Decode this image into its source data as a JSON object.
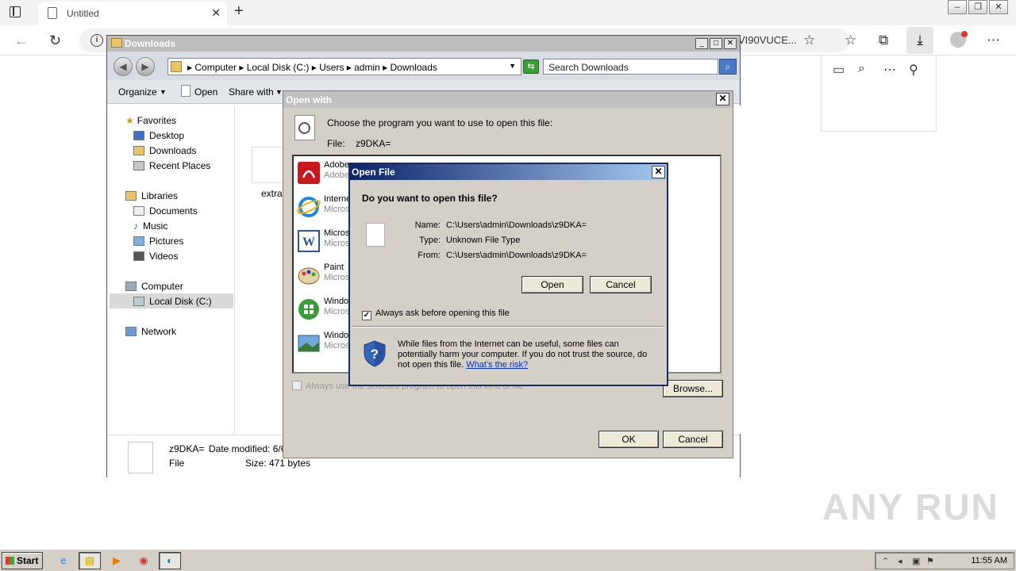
{
  "browser": {
    "tab_title": "Untitled",
    "url_fragment": "VI90VUCE...",
    "new_tab_icon": "plus-icon"
  },
  "explorer": {
    "title": "Downloads",
    "breadcrumb": "▸  Computer  ▸  Local Disk (C:)  ▸  Users  ▸  admin  ▸  Downloads",
    "search_placeholder": "Search Downloads",
    "cmd": {
      "organize": "Organize",
      "open": "Open",
      "share_with": "Share with"
    },
    "nav": {
      "favorites": "Favorites",
      "desktop": "Desktop",
      "downloads": "Downloads",
      "recent": "Recent Places",
      "libraries": "Libraries",
      "documents": "Documents",
      "music": "Music",
      "pictures": "Pictures",
      "videos": "Videos",
      "computer": "Computer",
      "local_disk": "Local Disk (C:)",
      "network": "Network"
    },
    "file_label": "extra",
    "details": {
      "name": "z9DKA=",
      "modified": "Date modified: 6/6/",
      "type": "File",
      "size": "Size: 471 bytes"
    }
  },
  "open_with": {
    "title": "Open with",
    "instruction": "Choose the program you want to use to open this file:",
    "file_label": "File:",
    "file_name": "z9DKA=",
    "programs": [
      {
        "name": "Adobe",
        "publisher": "Adobe"
      },
      {
        "name": "Interne",
        "publisher": "Micros"
      },
      {
        "name": "Micros",
        "publisher": "Micros"
      },
      {
        "name": "Paint",
        "publisher": "Micros"
      },
      {
        "name": "Windo",
        "publisher": "Micros"
      },
      {
        "name": "Windo",
        "publisher": "Micros"
      }
    ],
    "always_use": "Always use the selected program to open this kind of file",
    "browse": "Browse...",
    "ok": "OK",
    "cancel": "Cancel"
  },
  "open_file": {
    "title": "Open File",
    "question": "Do you want to open this file?",
    "name_label": "Name:",
    "name_value": "C:\\Users\\admin\\Downloads\\z9DKA=",
    "type_label": "Type:",
    "type_value": "Unknown File Type",
    "from_label": "From:",
    "from_value": "C:\\Users\\admin\\Downloads\\z9DKA=",
    "open": "Open",
    "cancel": "Cancel",
    "always_ask": "Always ask before opening this file",
    "always_ask_checked": true,
    "warning": "While files from the Internet can be useful, some files can potentially harm your computer. If you do not trust the source, do not open this file.",
    "risk_link": "What's the risk?"
  },
  "watermark": "ANY RUN",
  "taskbar": {
    "start": "Start",
    "clock": "11:55 AM"
  }
}
